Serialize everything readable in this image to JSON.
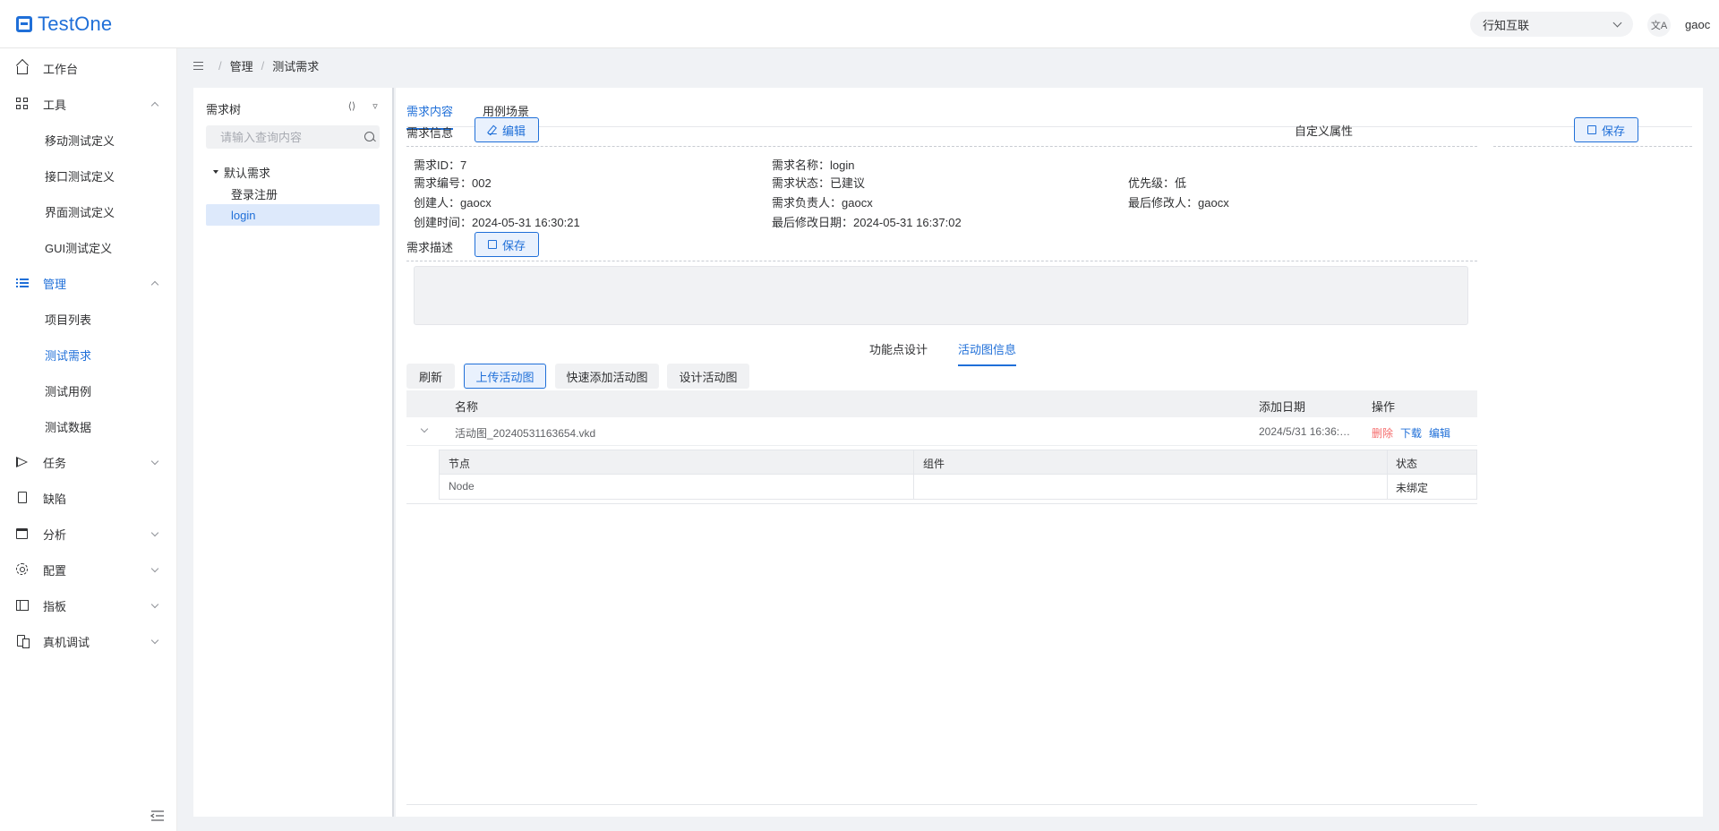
{
  "header": {
    "logo": "TestOne",
    "project_select": "行知互联",
    "lang_icon": "文A",
    "user": "gaoc"
  },
  "sidebar": {
    "items": [
      {
        "label": "工作台",
        "icon": "home-icon"
      },
      {
        "label": "工具",
        "icon": "grid-icon"
      },
      {
        "label": "管理",
        "icon": "list-icon"
      },
      {
        "label": "任务",
        "icon": "send-icon"
      },
      {
        "label": "缺陷",
        "icon": "document-icon"
      },
      {
        "label": "分析",
        "icon": "calendar-icon"
      },
      {
        "label": "配置",
        "icon": "gear-icon"
      },
      {
        "label": "指板",
        "icon": "board-icon"
      },
      {
        "label": "真机调试",
        "icon": "phone-icon"
      }
    ],
    "tools_sub": [
      "移动测试定义",
      "接口测试定义",
      "界面测试定义",
      "GUI测试定义"
    ],
    "manage_sub": [
      "项目列表",
      "测试需求",
      "测试用例",
      "测试数据"
    ]
  },
  "breadcrumb": [
    "管理",
    "测试需求"
  ],
  "tree": {
    "title": "需求树",
    "search_placeholder": "请输入查询内容",
    "root": "默认需求",
    "children": [
      "登录注册",
      "login"
    ]
  },
  "main": {
    "tabs": [
      "需求内容",
      "用例场景"
    ],
    "info_title": "需求信息",
    "edit_btn": "编辑",
    "custom_title": "自定义属性",
    "save_btn": "保存",
    "desc_title": "需求描述",
    "fields": {
      "id": "需求ID：7",
      "name": "需求名称：login",
      "code": "需求编号：002",
      "status": "需求状态：已建议",
      "priority": "优先级：低",
      "creator": "创建人：gaocx",
      "owner": "需求负责人：gaocx",
      "modifier": "最后修改人：gaocx",
      "created": "创建时间：2024-05-31 16:30:21",
      "modified": "最后修改日期：2024-05-31 16:37:02"
    },
    "subtabs": [
      "功能点设计",
      "活动图信息"
    ],
    "actions": [
      "刷新",
      "上传活动图",
      "快速添加活动图",
      "设计活动图"
    ],
    "table": {
      "headers": [
        "名称",
        "添加日期",
        "操作"
      ],
      "row": {
        "name": "活动图_20240531163654.vkd",
        "date": "2024/5/31 16:36:…",
        "ops": [
          "删除",
          "下载",
          "编辑"
        ]
      }
    },
    "inner_table": {
      "headers": [
        "节点",
        "组件",
        "状态"
      ],
      "row": {
        "node": "Node",
        "component": "",
        "status": "未绑定"
      }
    }
  },
  "colors": {
    "accent": "#1f6fd8",
    "danger": "#f56c6c"
  }
}
